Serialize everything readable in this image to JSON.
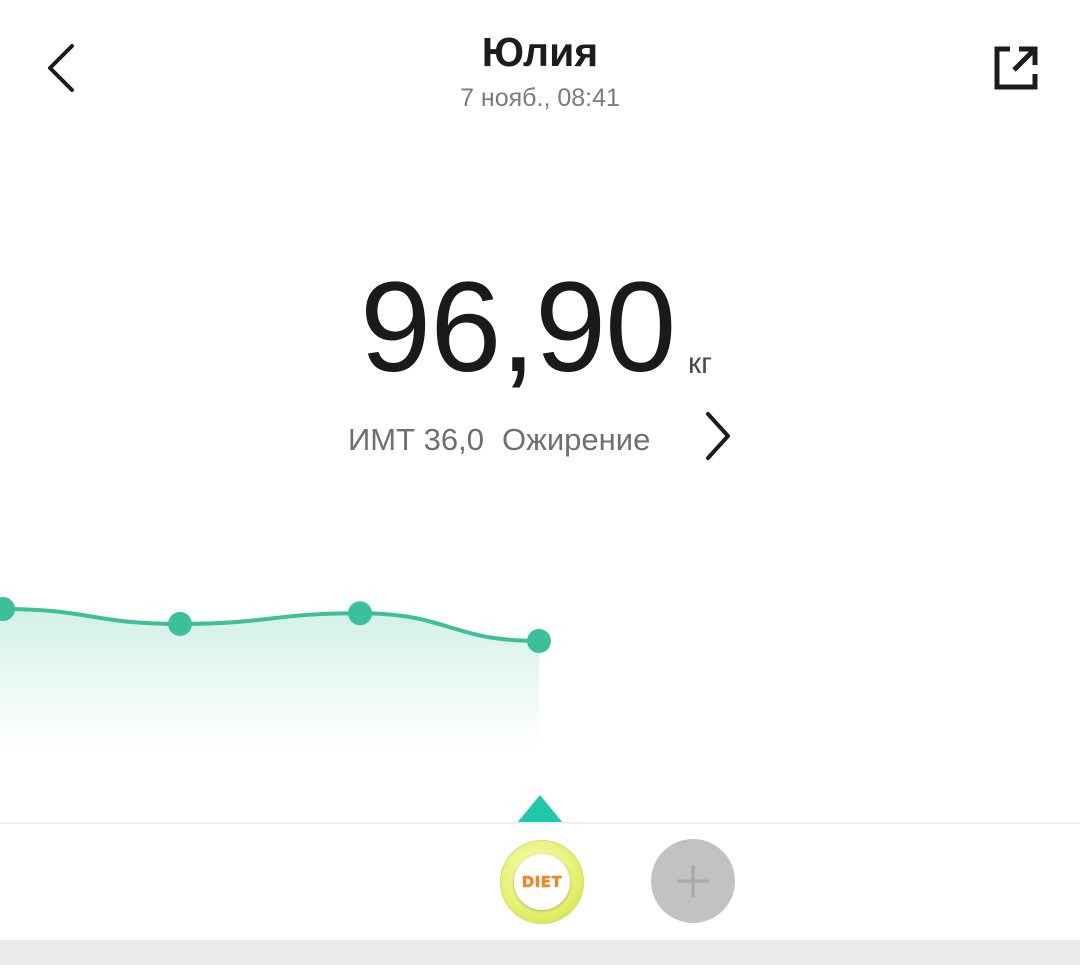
{
  "header": {
    "title": "Юлия",
    "subtitle": "7 нояб., 08:41",
    "back_icon": "chevron-left-icon",
    "share_icon": "external-link-icon"
  },
  "measurement": {
    "weight": "96,90",
    "unit": "кг",
    "bmi_label": "ИМТ 36,0",
    "bmi_status": "Ожирение",
    "details_icon": "chevron-right-icon"
  },
  "chart_data": {
    "type": "area",
    "series": [
      {
        "values": [
          97.05,
          96.98,
          97.03,
          96.9
        ]
      }
    ],
    "grid": false,
    "colors": {
      "line": "#3cbf9a",
      "fill_top": "#d3f1e6",
      "fill_bottom": "#ffffff",
      "pointer": "#22c7a9"
    }
  },
  "bottom_bar": {
    "diet_label": "DIET",
    "add_icon": "plus-icon"
  }
}
